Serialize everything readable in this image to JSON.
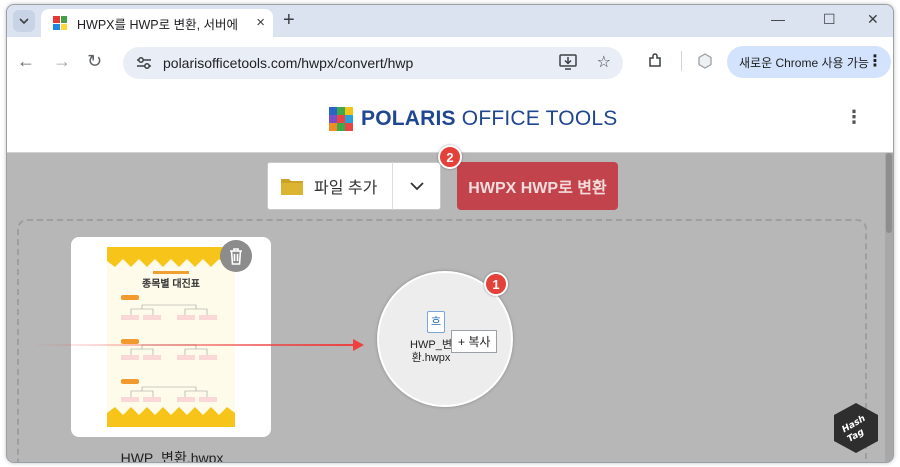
{
  "browser": {
    "tab_title": "HWPX를 HWP로 변환, 서버에",
    "tab_close": "×",
    "new_tab": "+",
    "window_controls": [
      "—",
      "☐",
      "✕"
    ],
    "url": "polarisofficetools.com/hwpx/convert/hwp",
    "chrome_promo": "새로운 Chrome 사용 가능",
    "icons": [
      "back-icon",
      "forward-icon",
      "reload-icon",
      "site-info-icon",
      "install-app-icon",
      "bookmark-star-icon",
      "extensions-icon",
      "profile-icon",
      "menu-kebab-icon"
    ]
  },
  "header": {
    "logo_bold": "POLARIS",
    "logo_rest": " OFFICE TOOLS"
  },
  "toolbar": {
    "add_file_label": "파일 추가",
    "convert_label": "HWPX HWP로 변환"
  },
  "file": {
    "name": "HWP_변환.hwpx",
    "thumb_title": "종목별 대진표"
  },
  "drag": {
    "file_glyph": "흐",
    "label": "HWP_변환.hwpx",
    "copy_badge": "+ 복사"
  },
  "annotations": {
    "step1": "1",
    "step2": "2"
  },
  "colors": {
    "convert_button": "#c2434b",
    "logo_text": "#1f4690",
    "badge": "#e3413a",
    "arrow": "#ee4040"
  }
}
